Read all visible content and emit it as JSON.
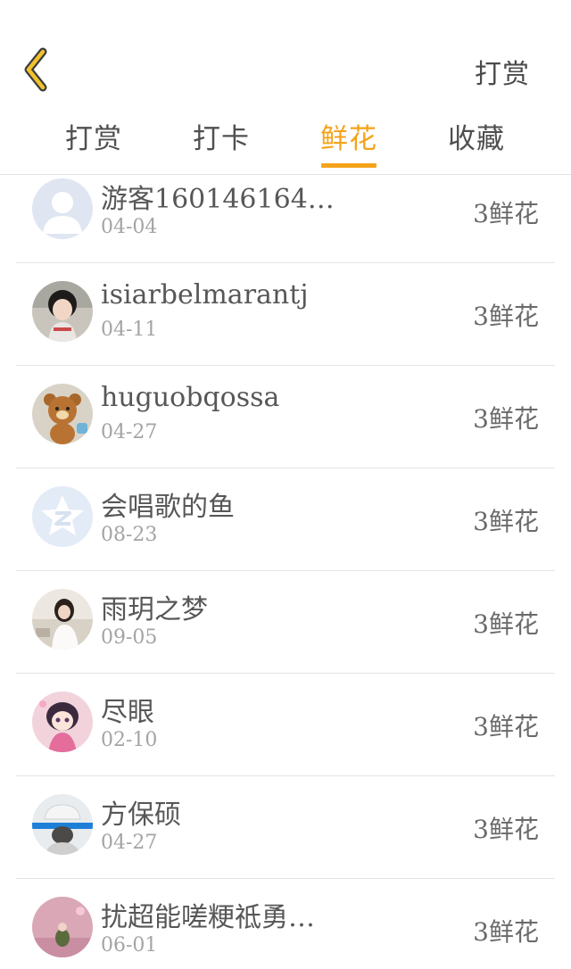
{
  "header": {
    "back_icon": "chevron-left-icon",
    "right_action": "打赏",
    "accent_color": "#f5a31a"
  },
  "tabs": [
    {
      "label": "打赏",
      "active": false
    },
    {
      "label": "打卡",
      "active": false
    },
    {
      "label": "鲜花",
      "active": true
    },
    {
      "label": "收藏",
      "active": false
    }
  ],
  "records": [
    {
      "name": "游客160146164…",
      "date": "04-04",
      "amount": "3鲜花",
      "avatar": "default-user-avatar"
    },
    {
      "name": "isiarbelmarantj",
      "date": "04-11",
      "amount": "3鲜花",
      "avatar": "girl-photo-avatar"
    },
    {
      "name": "huguobqossa",
      "date": "04-27",
      "amount": "3鲜花",
      "avatar": "teddy-bear-avatar"
    },
    {
      "name": "会唱歌的鱼",
      "date": "08-23",
      "amount": "3鲜花",
      "avatar": "qzone-logo-avatar"
    },
    {
      "name": "雨玥之梦",
      "date": "09-05",
      "amount": "3鲜花",
      "avatar": "woman-photo-avatar"
    },
    {
      "name": "尽眼",
      "date": "02-10",
      "amount": "3鲜花",
      "avatar": "anime-girl-avatar"
    },
    {
      "name": "方保硕",
      "date": "04-27",
      "amount": "3鲜花",
      "avatar": "capped-person-avatar"
    },
    {
      "name": "扰超能嗟粳祗勇…",
      "date": "06-01",
      "amount": "3鲜花",
      "avatar": "pink-scene-avatar"
    }
  ]
}
